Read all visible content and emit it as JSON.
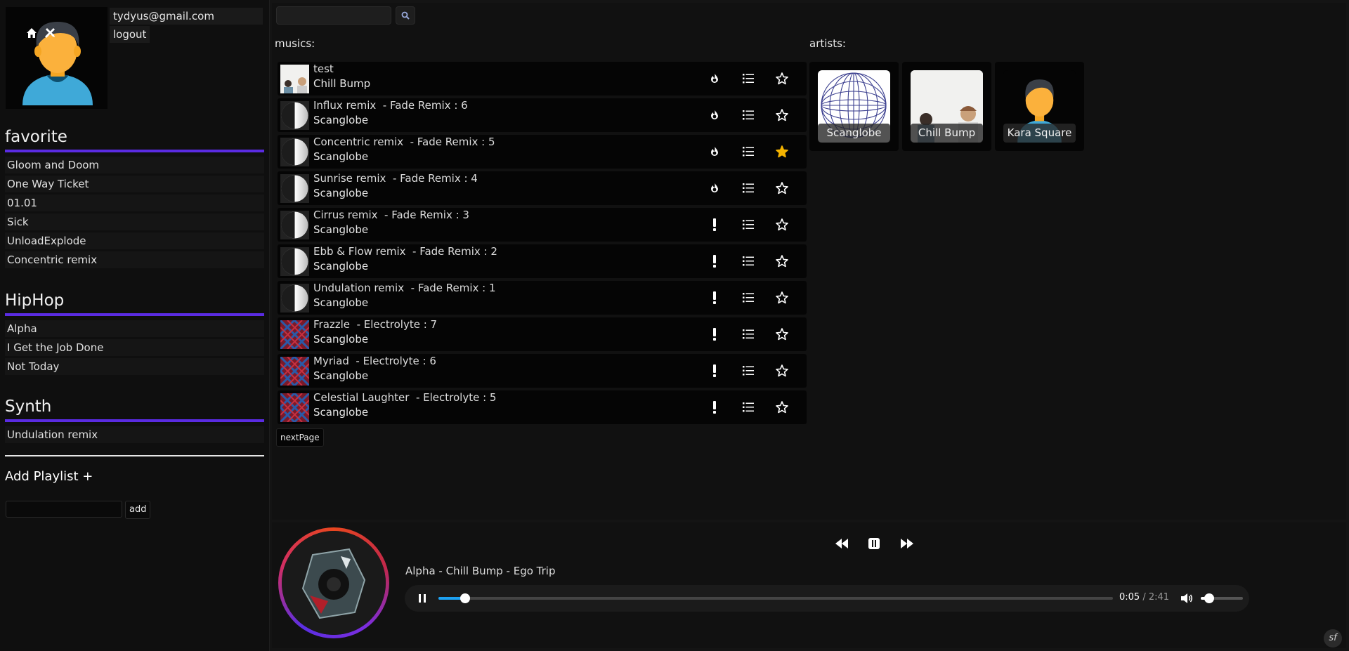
{
  "user": {
    "email": "tydyus@gmail.com",
    "logout_label": "logout"
  },
  "icons": {
    "home": "home-icon",
    "tools": "tools-icon"
  },
  "playlists": [
    {
      "title": "favorite",
      "items": [
        "Gloom and Doom",
        "One Way Ticket",
        "01.01",
        "Sick",
        "UnloadExplode",
        "Concentric remix"
      ]
    },
    {
      "title": "HipHop",
      "items": [
        "Alpha",
        "I Get the Job Done",
        "Not Today"
      ]
    },
    {
      "title": "Synth",
      "items": [
        "Undulation remix"
      ]
    }
  ],
  "add_playlist": {
    "title": "Add Playlist +",
    "button_label": "add",
    "input_value": ""
  },
  "search": {
    "value": ""
  },
  "musics": {
    "label": "musics:",
    "tracks": [
      {
        "title": "test",
        "artist": "Chill Bump",
        "thumb": "photo",
        "status": "fire",
        "favorite": false
      },
      {
        "title": "Influx remix  - Fade Remix : 6",
        "artist": "Scanglobe",
        "thumb": "moon",
        "status": "fire",
        "favorite": false
      },
      {
        "title": "Concentric remix  - Fade Remix : 5",
        "artist": "Scanglobe",
        "thumb": "moon",
        "status": "fire",
        "favorite": true
      },
      {
        "title": "Sunrise remix  - Fade Remix : 4",
        "artist": "Scanglobe",
        "thumb": "moon",
        "status": "fire",
        "favorite": false
      },
      {
        "title": "Cirrus remix  - Fade Remix : 3",
        "artist": "Scanglobe",
        "thumb": "moon",
        "status": "alert",
        "favorite": false
      },
      {
        "title": "Ebb & Flow remix  - Fade Remix : 2",
        "artist": "Scanglobe",
        "thumb": "moon",
        "status": "alert",
        "favorite": false
      },
      {
        "title": "Undulation remix  - Fade Remix : 1",
        "artist": "Scanglobe",
        "thumb": "moon",
        "status": "alert",
        "favorite": false
      },
      {
        "title": "Frazzle  - Electrolyte : 7",
        "artist": "Scanglobe",
        "thumb": "pattern",
        "status": "alert",
        "favorite": false
      },
      {
        "title": "Myriad  - Electrolyte : 6",
        "artist": "Scanglobe",
        "thumb": "pattern",
        "status": "alert",
        "favorite": false
      },
      {
        "title": "Celestial Laughter  - Electrolyte : 5",
        "artist": "Scanglobe",
        "thumb": "pattern",
        "status": "alert",
        "favorite": false
      }
    ],
    "next_page_label": "nextPage"
  },
  "artists": {
    "label": "artists:",
    "items": [
      {
        "name": "Scanglobe",
        "pic": "globe"
      },
      {
        "name": "Chill Bump",
        "pic": "photo"
      },
      {
        "name": "Kara Square",
        "pic": "avatar"
      }
    ]
  },
  "player": {
    "now_playing": "Alpha - Chill Bump - Ego Trip",
    "current_time": "0:05",
    "total_time": "2:41",
    "progress": 0.04,
    "volume": 0.2
  },
  "colors": {
    "accent": "#5a2be2",
    "progress": "#1da1f2",
    "favorite_star": "#f5b400"
  }
}
